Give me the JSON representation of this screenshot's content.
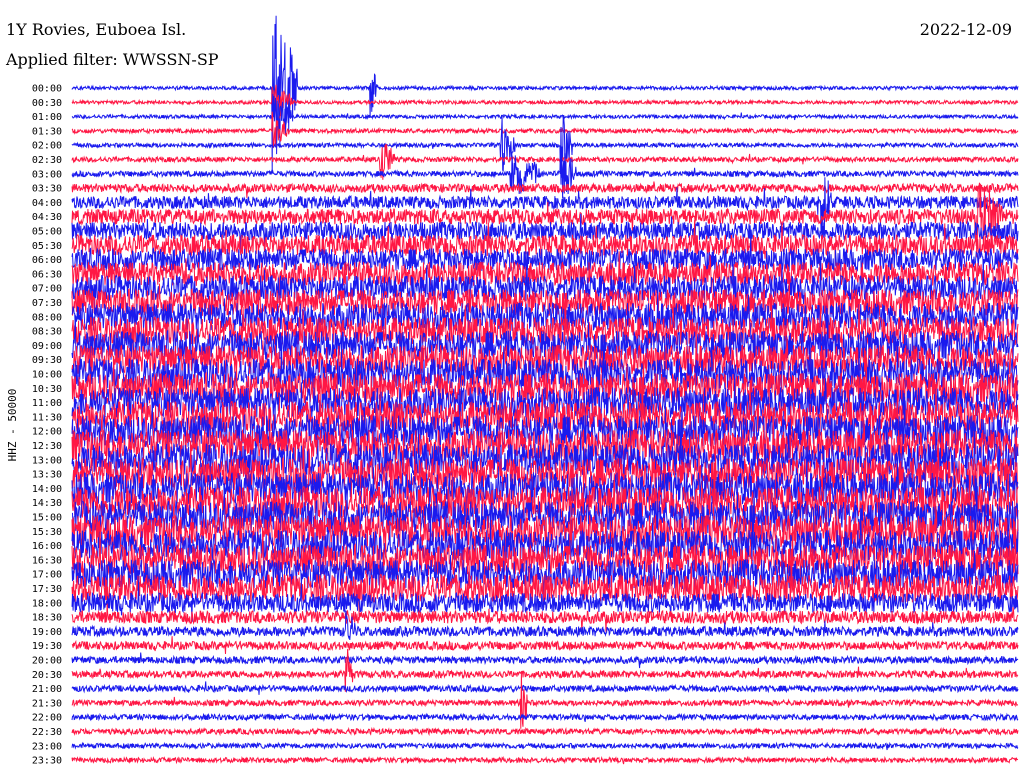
{
  "header": {
    "title": "1Y Rovies, Euboea Isl.",
    "filter": "Applied filter: WWSSN-SP",
    "date": "2022-12-09"
  },
  "chart_data": {
    "type": "line",
    "subtype": "helicorder",
    "ylabel": "HHZ - 50000",
    "row_labels": [
      "00:00",
      "00:30",
      "01:00",
      "01:30",
      "02:00",
      "02:30",
      "03:00",
      "03:30",
      "04:00",
      "04:30",
      "05:00",
      "05:30",
      "06:00",
      "06:30",
      "07:00",
      "07:30",
      "08:00",
      "08:30",
      "09:00",
      "09:30",
      "10:00",
      "10:30",
      "11:00",
      "11:30",
      "12:00",
      "12:30",
      "13:00",
      "13:30",
      "14:00",
      "14:30",
      "15:00",
      "15:30",
      "16:00",
      "16:30",
      "17:00",
      "17:30",
      "18:00",
      "18:30",
      "19:00",
      "19:30",
      "20:00",
      "20:30",
      "21:00",
      "21:30",
      "22:00",
      "22:30",
      "23:00",
      "23:30"
    ],
    "colors": [
      "#1a1aee",
      "#ff1744"
    ],
    "noise_level": [
      0.25,
      0.25,
      0.25,
      0.3,
      0.3,
      0.35,
      0.4,
      0.6,
      0.9,
      1.1,
      1.3,
      1.5,
      1.6,
      1.7,
      1.8,
      1.9,
      2.0,
      2.0,
      2.1,
      2.1,
      2.2,
      2.2,
      2.2,
      2.2,
      2.3,
      2.3,
      2.3,
      2.3,
      2.3,
      2.3,
      2.3,
      2.3,
      2.2,
      2.2,
      2.1,
      2.0,
      1.4,
      0.9,
      0.7,
      0.6,
      0.5,
      0.5,
      0.45,
      0.4,
      0.4,
      0.4,
      0.35,
      0.35
    ]
  }
}
